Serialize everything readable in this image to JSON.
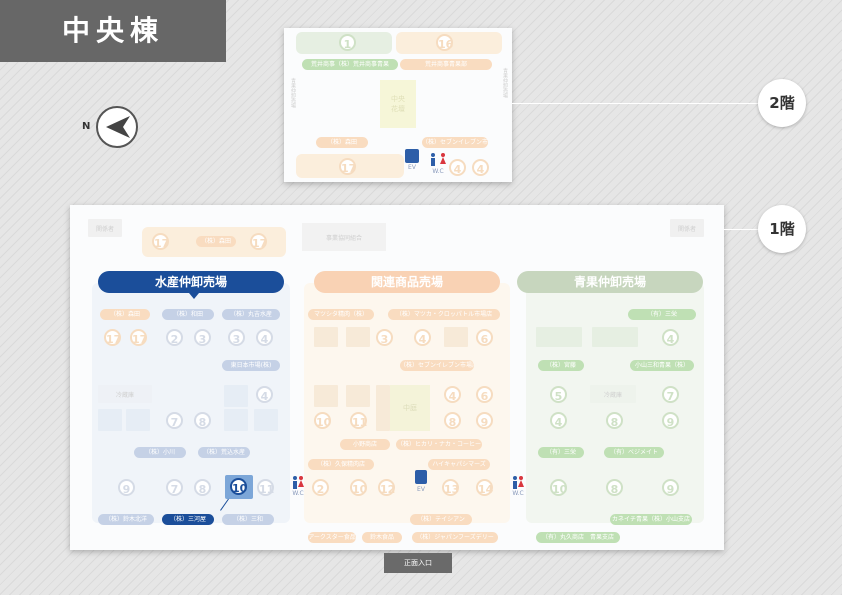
{
  "building_title": "中央棟",
  "compass_label": "N",
  "floors": {
    "upper": "2階",
    "lower": "1階"
  },
  "entrance": "正面入口",
  "floor2": {
    "numbers": [
      "1",
      "16",
      "17",
      "4",
      "4"
    ],
    "labels": [
      "荒井商事（株）荒井商事青果",
      "荒井商事青果部",
      "（株）森田",
      "（株）セブンイレブン市場店"
    ],
    "center_block": "中央\n花壇",
    "vert_left": "青果仲卸売場",
    "vert_right": "青果仲卸売場",
    "ev": "EV",
    "wc": "W.C"
  },
  "floor1": {
    "top_notes": [
      "関係者",
      "（株）森田",
      "事業協同組合",
      "関係者"
    ],
    "top_numbers": [
      "17",
      "17"
    ],
    "headers": {
      "fish": "水産仲卸売場",
      "related": "関連商品売場",
      "produce": "青果仲卸売場"
    },
    "fish": {
      "labels_top": [
        "（株）森田",
        "（株）和田",
        "（株）丸吉水産"
      ],
      "numbers_top": [
        "17",
        "17",
        "2",
        "3",
        "3",
        "4"
      ],
      "label_mid": "東日本市場(株)",
      "note_block": "冷蔵庫",
      "numbers_mid": [
        "4",
        "7",
        "8"
      ],
      "labels_low": [
        "（株）小川",
        "（株）荒込水産"
      ],
      "numbers_bottom": [
        "9",
        "7",
        "8",
        "10",
        "11"
      ],
      "selected_number": "10",
      "labels_bottom": [
        "（株）鈴木北洋",
        "（株）三河屋",
        "（株）三和"
      ],
      "selected_label": "（株）三河屋"
    },
    "related": {
      "labels_top": [
        "マツシタ精肉（株）",
        "（株）マツカ・クロッパトル市場店"
      ],
      "numbers_top": [
        "3",
        "4",
        "6"
      ],
      "label_seven": "（株）セブンイレブン市場店",
      "center_block": "中庭",
      "numbers_mid": [
        "4",
        "6",
        "10",
        "11",
        "8",
        "9"
      ],
      "labels_mid": [
        "小野商店",
        "（株）ヒカリ・ナカ・コーヒー"
      ],
      "labels_low": [
        "（株）久保精肉店",
        "ハイキャパシマーズ"
      ],
      "numbers_bottom": [
        "2",
        "10",
        "12",
        "13",
        "14"
      ],
      "labels_bottom": [
        "（株）テイシアン",
        "アークスター食品",
        "鈴木食品",
        "（株）ジャパンフーズデリー"
      ],
      "ev": "EV",
      "wc_left": "W.C",
      "wc_right": "W.C"
    },
    "produce": {
      "labels_top": [
        "（有）三栄"
      ],
      "numbers_top": [
        "4"
      ],
      "labels_mid": [
        "（株）宮藤",
        "小山三和青果（株）"
      ],
      "note_block": "冷蔵庫",
      "numbers_mid": [
        "5",
        "7",
        "4",
        "8",
        "9"
      ],
      "labels_low": [
        "（有）三栄",
        "（有）ベジメイト"
      ],
      "numbers_bottom": [
        "10",
        "8",
        "9"
      ],
      "labels_bottom": [
        "カネイチ青果（株）小山支店",
        "（有）丸久商店　青果支店"
      ]
    }
  }
}
